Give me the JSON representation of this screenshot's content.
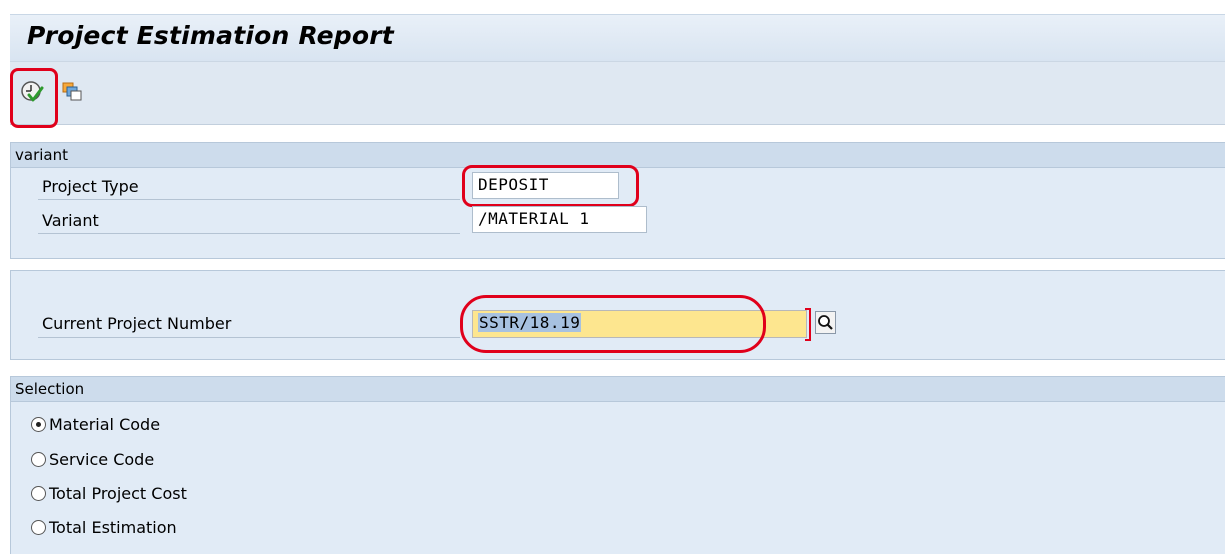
{
  "window": {
    "title": "Project Estimation Report"
  },
  "toolbar": {
    "execute_icon": "execute-clock-check-icon",
    "multiple_selection_icon": "multiple-selection-icon"
  },
  "variant_panel": {
    "header": "variant",
    "project_type_label": "Project Type",
    "project_type_value": "DEPOSIT",
    "variant_label": "Variant",
    "variant_value": "/MATERIAL 1"
  },
  "project_panel": {
    "current_project_label": "Current Project Number",
    "current_project_value": "SSTR/18.19",
    "search_icon": "search-help-icon"
  },
  "selection_panel": {
    "header": "Selection",
    "options": [
      {
        "label": "Material Code",
        "selected": true
      },
      {
        "label": "Service Code",
        "selected": false
      },
      {
        "label": "Total Project Cost",
        "selected": false
      },
      {
        "label": "Total Estimation",
        "selected": false
      }
    ]
  },
  "colors": {
    "annotation_red": "#e0001b",
    "panel_background": "#e1ebf6",
    "required_field": "#fde68f",
    "header_background": "#cddcec"
  }
}
